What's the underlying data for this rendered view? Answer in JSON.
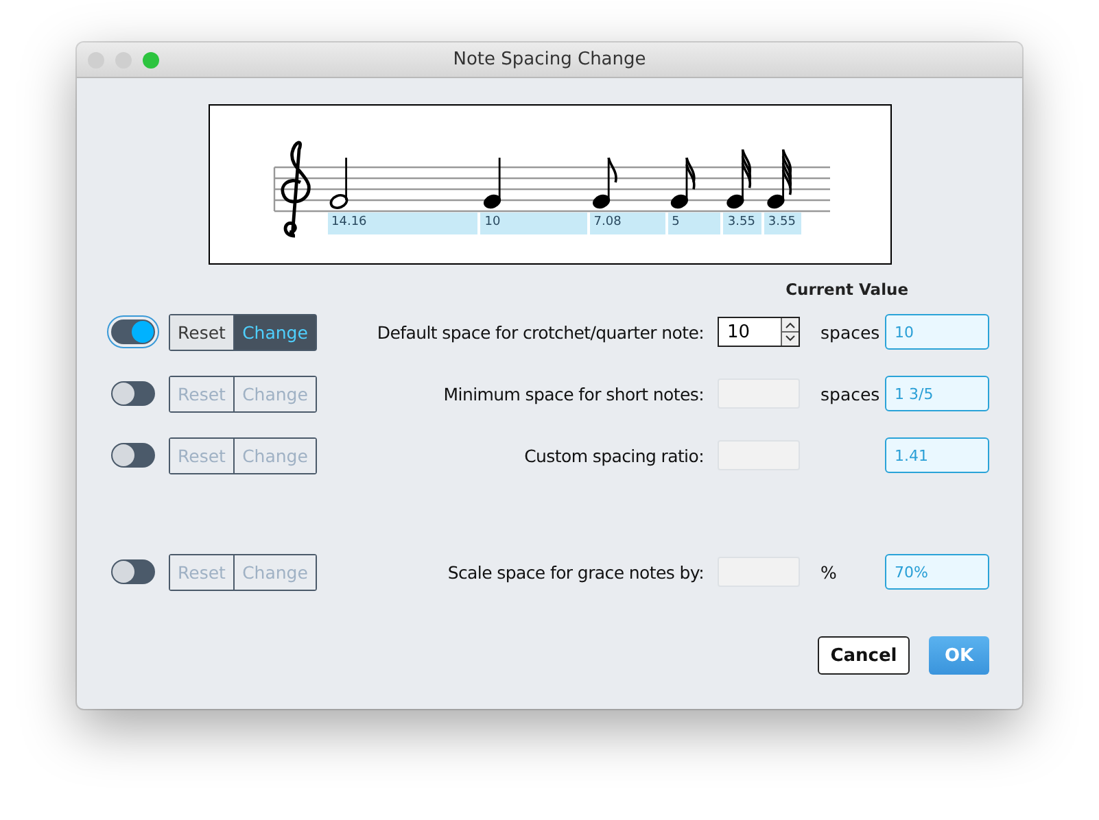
{
  "window": {
    "title": "Note Spacing Change"
  },
  "preview": {
    "notes": [
      {
        "kind": "half",
        "label": "14.16"
      },
      {
        "kind": "quarter",
        "label": "10"
      },
      {
        "kind": "eighth",
        "label": "7.08"
      },
      {
        "kind": "sixteenth",
        "label": "5"
      },
      {
        "kind": "thirty-second",
        "label": "3.55"
      },
      {
        "kind": "sixty-fourth",
        "label": "3.55"
      }
    ]
  },
  "current_value_header": "Current Value",
  "rows": [
    {
      "on": true,
      "disabled": false,
      "reset": {
        "label": "Reset",
        "selected": false
      },
      "change": {
        "label": "Change",
        "selected": true
      },
      "label": "Default space for crotchet/quarter note:",
      "input": {
        "kind": "spinner",
        "value": "10"
      },
      "unit": "spaces",
      "current": "10"
    },
    {
      "on": false,
      "disabled": true,
      "reset": {
        "label": "Reset",
        "selected": false
      },
      "change": {
        "label": "Change",
        "selected": false
      },
      "label": "Minimum space for short notes:",
      "input": {
        "kind": "text"
      },
      "unit": "spaces",
      "current": "1 3/5"
    },
    {
      "on": false,
      "disabled": true,
      "reset": {
        "label": "Reset",
        "selected": false
      },
      "change": {
        "label": "Change",
        "selected": false
      },
      "label": "Custom spacing ratio:",
      "input": {
        "kind": "text"
      },
      "current": "1.41"
    },
    {
      "on": false,
      "disabled": true,
      "reset": {
        "label": "Reset",
        "selected": false
      },
      "change": {
        "label": "Change",
        "selected": false
      },
      "label": "Scale space for grace notes by:",
      "input": {
        "kind": "text"
      },
      "unit": "%",
      "current": "70%"
    }
  ],
  "buttons": [
    {
      "kind": "secondary",
      "label": "Cancel"
    },
    {
      "kind": "primary",
      "label": "OK"
    }
  ]
}
